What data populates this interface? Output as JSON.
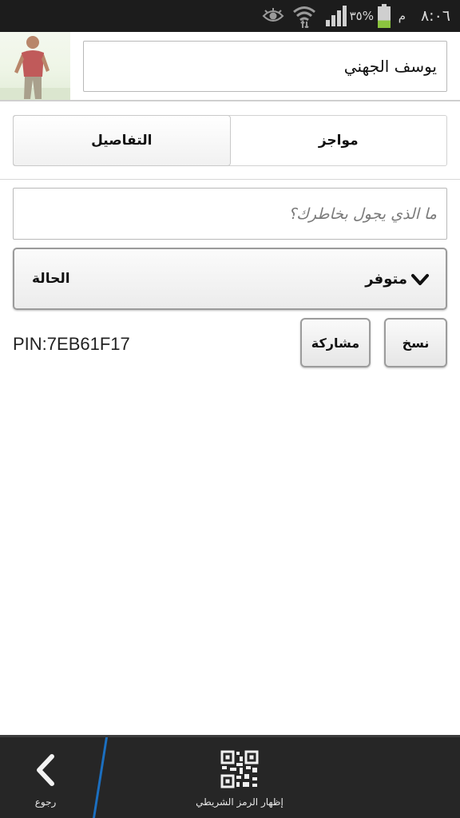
{
  "status_bar": {
    "time": "٨:٠٦",
    "ampm": "م",
    "battery_percent": "٣٥%",
    "battery_level": 0.35,
    "battery_color": "#8bc43f"
  },
  "profile": {
    "name": "يوسف الجهني"
  },
  "tabs": {
    "details_label": "التفاصيل",
    "barcode_tab_label": "مواجز"
  },
  "status_message": {
    "placeholder": "ما الذي يجول بخاطرك؟"
  },
  "availability": {
    "label": "الحالة",
    "value": "متوفر"
  },
  "pin": {
    "text": "PIN:7EB61F17"
  },
  "actions": {
    "copy_label": "نسخ",
    "share_label": "مشاركة"
  },
  "bottom_bar": {
    "back_label": "رجوع",
    "show_barcode_label": "إظهار الرمز الشريطي",
    "accent_color": "#1b6fc0"
  }
}
